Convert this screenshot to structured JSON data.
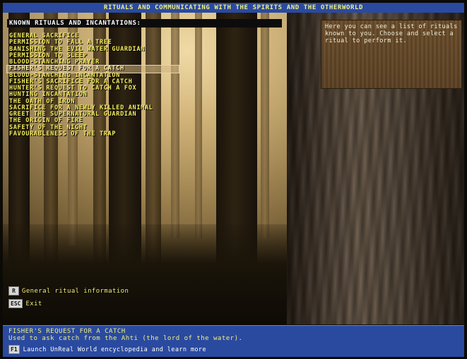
{
  "title": "RITUALS AND COMMUNICATING WITH THE SPIRITS AND THE OTHERWORLD",
  "list": {
    "header": "KNOWN RITUALS AND INCANTATIONS:",
    "selected_index": 5,
    "items": [
      "GENERAL SACRIFICE",
      "PERMISSION TO FALL A TREE",
      "BANISHING THE EVIL WATER GUARDIAN",
      "PERMISSION TO SLEEP",
      "BLOOD-STANCHING PRAYER",
      "FISHER'S REQUEST FOR A CATCH",
      "BLOOD-STANCHING INCANTATION",
      "FISHER'S SACRIFICE FOR A CATCH",
      "HUNTER'S REQUEST TO CATCH A FOX",
      "HUNTING INCANTATION",
      "THE OATH OF IRON",
      "SACRIFICE FOR A NEWLY KILLED ANIMAL",
      "GREET THE SUPERNATURAL GUARDIAN",
      "THE ORIGIN OF FIRE",
      "SAFETY OF THE NIGHT",
      "FAVOURABLENESS OF THE TRAP"
    ]
  },
  "info_panel": {
    "text": "Here you can see a list of rituals known to you. Choose and select a ritual to perform it."
  },
  "keys": {
    "general": {
      "key": "R",
      "label": "General ritual information"
    },
    "exit": {
      "key": "ESC",
      "label": "Exit"
    }
  },
  "bottom": {
    "selected_title": "FISHER'S REQUEST FOR A CATCH",
    "selected_desc": "Used to ask catch from the Ahti (the lord of the water).",
    "help_key": "F1",
    "help_label": "Launch UnReal World encyclopedia and learn more"
  },
  "colors": {
    "title_bar_bg": "#2a4aa0",
    "title_text": "#f2ee7a",
    "list_text": "#f3ef5e",
    "bottom_bar_bg": "#2a4aa0"
  }
}
